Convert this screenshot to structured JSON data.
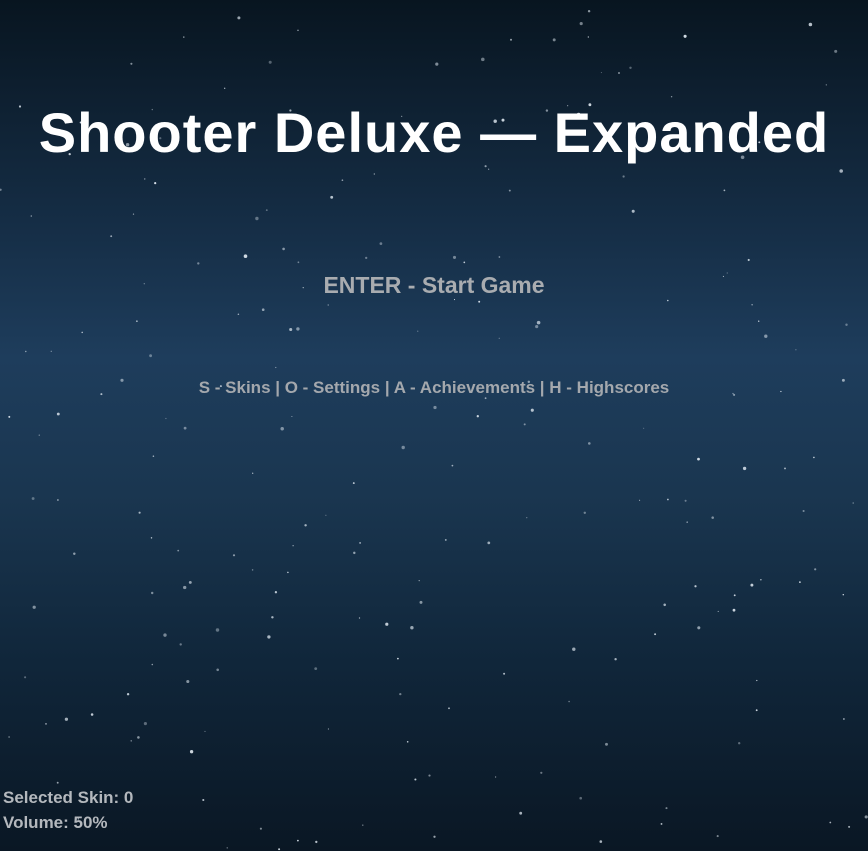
{
  "game": {
    "title": "Shooter Deluxe — Expanded",
    "start_prompt": "ENTER - Start Game",
    "menu_options": "S - Skins | O - Settings | A - Achievements | H - Highscores"
  },
  "status": {
    "selected_skin": "Selected Skin: 0",
    "volume": "Volume: 50%"
  },
  "colors": {
    "title": "#ffffff",
    "prompt": "#a9acb0",
    "star": "#dfe8f0"
  }
}
